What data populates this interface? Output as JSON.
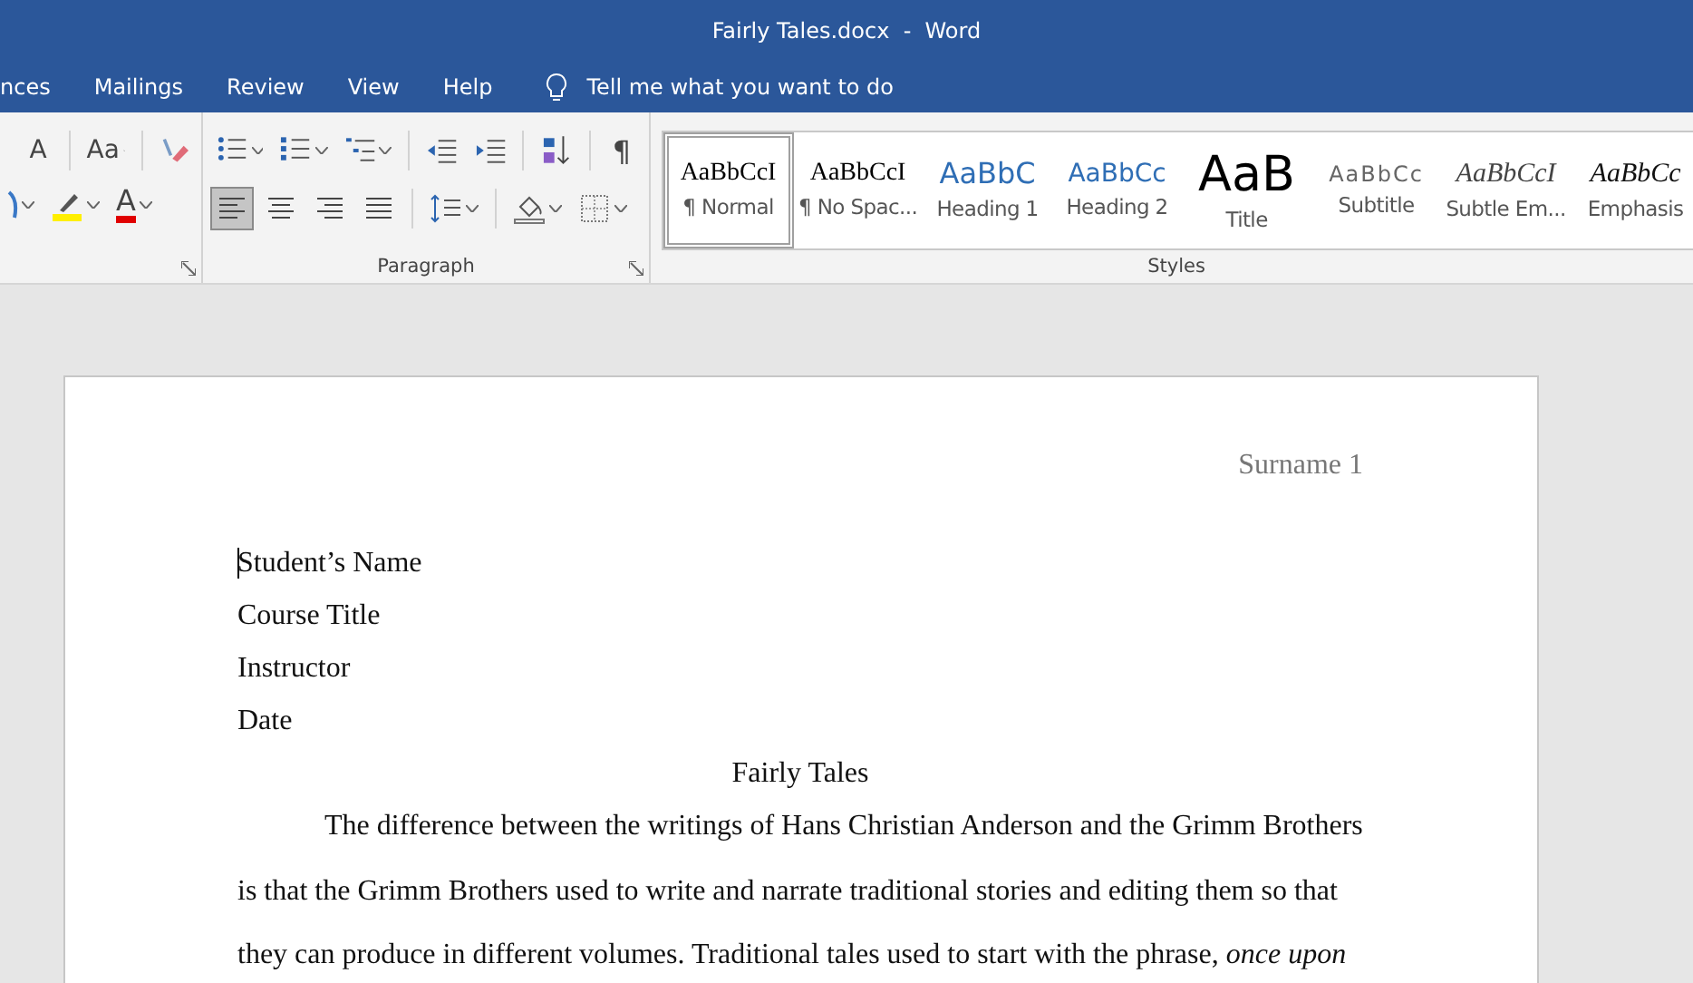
{
  "window": {
    "title": "Fairly Tales.docx  -  Word"
  },
  "tabs": [
    {
      "label": "nces"
    },
    {
      "label": "Mailings"
    },
    {
      "label": "Review"
    },
    {
      "label": "View"
    },
    {
      "label": "Help"
    }
  ],
  "tell_me": {
    "placeholder": "Tell me what you want to do"
  },
  "font_group": {
    "row1": [
      {
        "kind": "shrink",
        "glyph": "A"
      },
      {
        "kind": "case",
        "glyph": "Aa"
      },
      {
        "kind": "clear"
      }
    ],
    "row2": [
      {
        "kind": "effects"
      },
      {
        "kind": "highlight"
      },
      {
        "kind": "fontcolor",
        "glyph": "A"
      }
    ]
  },
  "paragraph_group": {
    "label": "Paragraph",
    "pilcrow": "¶",
    "alignments": [
      {
        "kind": "left",
        "selected": true
      },
      {
        "kind": "center",
        "selected": false
      },
      {
        "kind": "right",
        "selected": false
      },
      {
        "kind": "justify",
        "selected": false
      }
    ]
  },
  "styles": {
    "label": "Styles",
    "items": [
      {
        "kind": "normal",
        "preview": "AaBbCcI",
        "name": "¶ Normal",
        "selected": true
      },
      {
        "kind": "nospacing",
        "preview": "AaBbCcI",
        "name": "¶ No Spac...",
        "selected": false
      },
      {
        "kind": "heading1",
        "preview": "AaBbC",
        "name": "Heading 1",
        "selected": false
      },
      {
        "kind": "heading2",
        "preview": "AaBbCc",
        "name": "Heading 2",
        "selected": false
      },
      {
        "kind": "title",
        "preview": "AaB",
        "name": "Title",
        "selected": false
      },
      {
        "kind": "subtitle",
        "preview": "AaBbCc",
        "name": "Subtitle",
        "selected": false
      },
      {
        "kind": "subtle",
        "preview": "AaBbCcI",
        "name": "Subtle Em...",
        "selected": false
      },
      {
        "kind": "emphasis",
        "preview": "AaBbCc",
        "name": "Emphasis",
        "selected": false
      }
    ]
  },
  "document": {
    "header": "Surname 1",
    "heading_lines": [
      "Student’s Name",
      "Course Title",
      "Instructor",
      "Date"
    ],
    "title": "Fairly Tales",
    "paragraph": "The difference between the writings of Hans Christian Anderson and the Grimm Brothers is that the Grimm Brothers used to write and narrate traditional stories and editing them so that they can produce in different volumes. Traditional tales used to start with the phrase, *once upon*"
  }
}
